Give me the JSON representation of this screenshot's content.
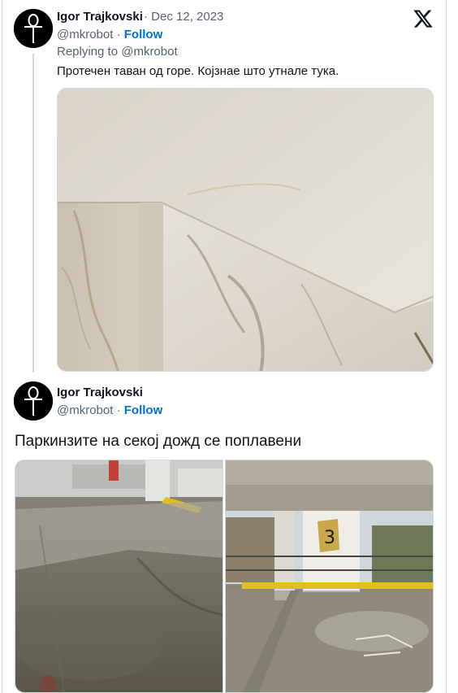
{
  "tweet1": {
    "author_name": "Igor Trajkovski",
    "separator": "·",
    "date": "Dec 12, 2023",
    "handle": "@mkrobot",
    "follow_label": "Follow",
    "replying_prefix": "Replying to",
    "replying_to": "@mkrobot",
    "text": "Протечен таван од горе. Којзнае што утнале тука."
  },
  "tweet2": {
    "author_name": "Igor Trajkovski",
    "handle": "@mkrobot",
    "separator": "·",
    "follow_label": "Follow",
    "text": "Паркинзите на секој дожд се поплавени"
  },
  "parking_sign": "3",
  "icons": {
    "brand": "x-logo-icon",
    "avatar": "ankh-avatar-icon"
  },
  "colors": {
    "link": "#006fd6",
    "secondary_text": "#536471",
    "border": "#cfd9de"
  }
}
